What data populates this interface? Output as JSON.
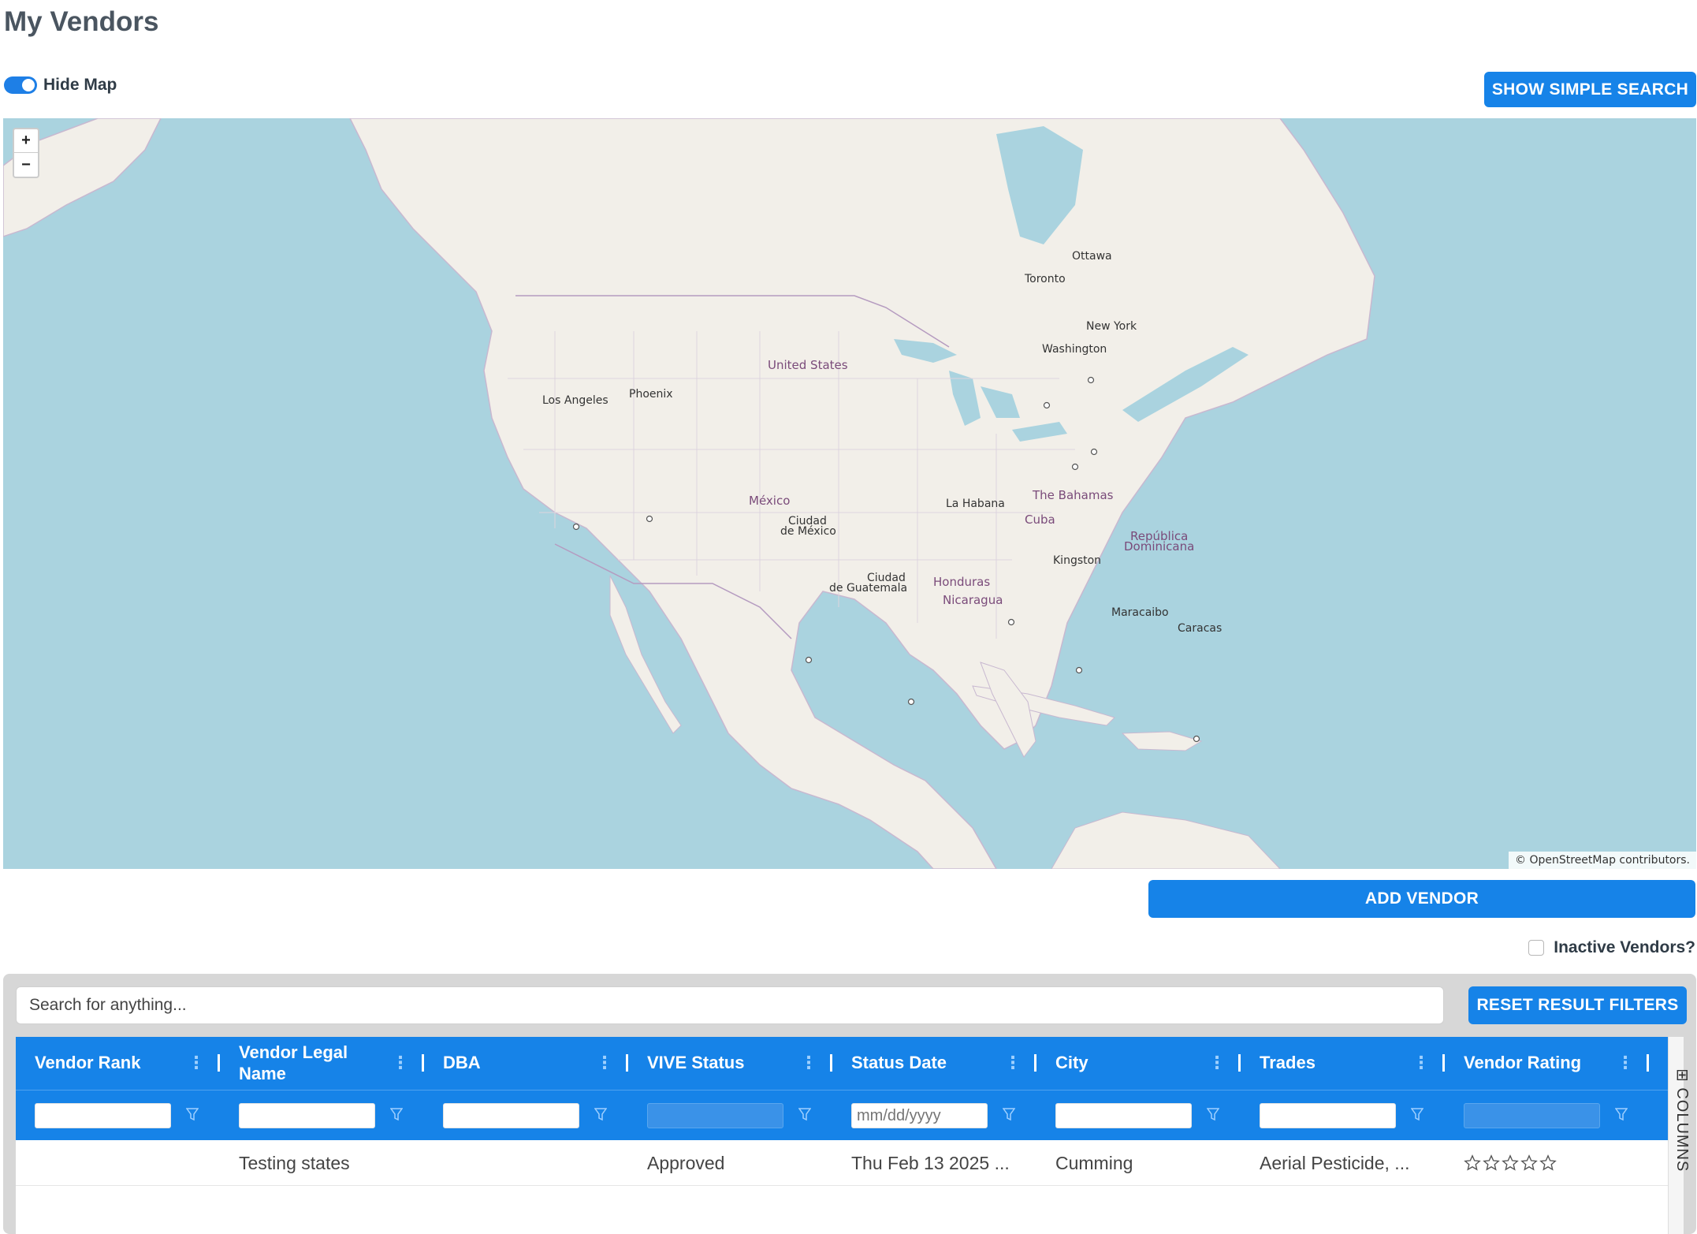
{
  "page": {
    "title": "My Vendors"
  },
  "map_toggle": {
    "label": "Hide Map",
    "checked": true
  },
  "buttons": {
    "simple_search": "SHOW SIMPLE SEARCH",
    "add_vendor": "ADD VENDOR",
    "reset_filters": "RESET RESULT FILTERS"
  },
  "map": {
    "zoom_in": "+",
    "zoom_out": "−",
    "attribution": "© OpenStreetMap contributors.",
    "labels": {
      "ottawa": "Ottawa",
      "toronto": "Toronto",
      "new_york": "New York",
      "washington": "Washington",
      "united_states": "United States",
      "phoenix": "Phoenix",
      "los_angeles": "Los Angeles",
      "mexico": "México",
      "ciudad_mexico_1": "Ciudad",
      "ciudad_mexico_2": "de México",
      "la_habana": "La Habana",
      "bahamas": "The Bahamas",
      "cuba": "Cuba",
      "republica_1": "República",
      "republica_2": "Dominicana",
      "kingston": "Kingston",
      "ciudad_guatemala_1": "Ciudad",
      "ciudad_guatemala_2": "de Guatemala",
      "honduras": "Honduras",
      "nicaragua": "Nicaragua",
      "maracaibo": "Maracaibo",
      "caracas": "Caracas"
    }
  },
  "inactive_vendors": {
    "label": "Inactive Vendors?",
    "checked": false
  },
  "search": {
    "placeholder": "Search for anything..."
  },
  "grid": {
    "columns": [
      "Vendor Rank",
      "Vendor Legal Name",
      "DBA",
      "VIVE Status",
      "Status Date",
      "City",
      "Trades",
      "Vendor Rating"
    ],
    "date_filter_placeholder": "mm/dd/yyyy",
    "rows": [
      {
        "vendor_rank": "",
        "vendor_legal_name": "Testing states",
        "dba": "",
        "vive_status": "Approved",
        "status_date": "Thu Feb 13 2025 ...",
        "city": "Cumming",
        "trades": "Aerial Pesticide, ...",
        "vendor_rating": 0
      }
    ],
    "side_panel": "COLUMNS"
  },
  "colors": {
    "accent": "#1683e8",
    "water": "#aad3df",
    "land": "#f2efe9"
  }
}
